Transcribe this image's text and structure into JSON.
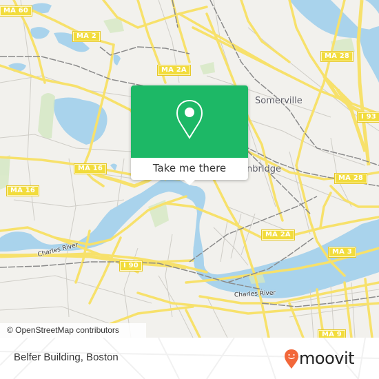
{
  "map": {
    "colors": {
      "land": "#f2f1ed",
      "water": "#a9d3ec",
      "park": "#d4e8c2",
      "major_road": "#f7e16b",
      "minor_road": "#c8c6c0",
      "rail": "#8a8a8a",
      "shield": "#f2dc3c"
    },
    "shields": [
      {
        "id": "ma60",
        "label": "MA 60"
      },
      {
        "id": "ma2",
        "label": "MA 2"
      },
      {
        "id": "ma2a-north",
        "label": "MA 2A"
      },
      {
        "id": "ma28-north",
        "label": "MA 28"
      },
      {
        "id": "i93",
        "label": "I 93"
      },
      {
        "id": "ma16-west",
        "label": "MA 16"
      },
      {
        "id": "ma16-mid",
        "label": "MA 16"
      },
      {
        "id": "ma28-south",
        "label": "MA 28"
      },
      {
        "id": "ma2a-south",
        "label": "MA 2A"
      },
      {
        "id": "ma3",
        "label": "MA 3"
      },
      {
        "id": "i90",
        "label": "I 90"
      },
      {
        "id": "ma9",
        "label": "MA 9"
      }
    ],
    "place_labels": {
      "somerville": "Somerville",
      "cambridge_partial": "nbridge"
    },
    "river_labels": {
      "charles_west": "Charles River",
      "charles_east": "Charles River"
    },
    "attribution": "© OpenStreetMap contributors"
  },
  "popup": {
    "button_label": "Take me there",
    "accent_color": "#1db866"
  },
  "footer": {
    "place_name": "Belfer Building, Boston",
    "brand": "moovit",
    "brand_color": "#f2673a"
  }
}
